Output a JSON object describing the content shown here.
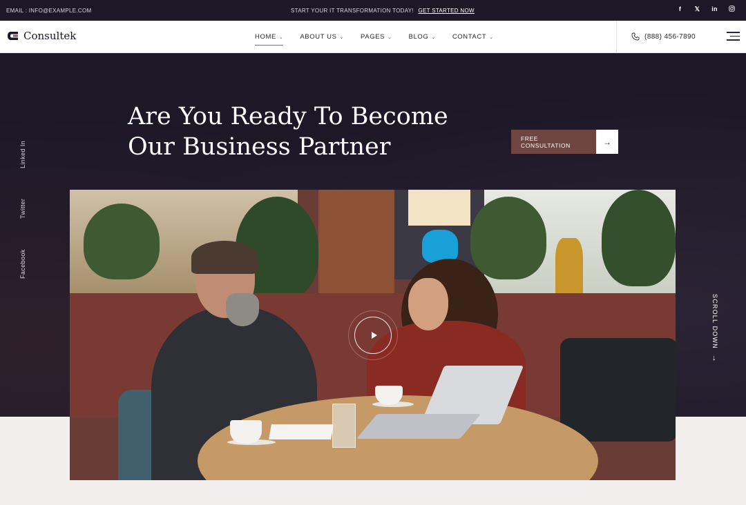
{
  "topbar": {
    "email": "EMAIL : INFO@EXAMPLE.COM",
    "promo_text": "START YOUR IT TRANSFORMATION TODAY!",
    "promo_link": "GET STARTED NOW",
    "socials": [
      "facebook-icon",
      "x-icon",
      "linkedin-icon",
      "instagram-icon"
    ]
  },
  "header": {
    "logo_text": "Consultek",
    "nav": [
      {
        "label": "HOME",
        "active": true
      },
      {
        "label": "ABOUT US",
        "active": false
      },
      {
        "label": "PAGES",
        "active": false
      },
      {
        "label": "BLOG",
        "active": false
      },
      {
        "label": "CONTACT",
        "active": false
      }
    ],
    "phone": "(888) 456-7890"
  },
  "hero": {
    "headline_line1": "Are You Ready To Become",
    "headline_line2": "Our Business Partner",
    "cta_label": "FREE CONSULTATION",
    "side_socials": [
      "Linked In",
      "Twitter",
      "Facebook"
    ],
    "scroll_label": "SCROLL DOWN"
  },
  "colors": {
    "dark": "#1d1828",
    "accent": "#6e4540",
    "light_bg": "#f3eeee"
  }
}
